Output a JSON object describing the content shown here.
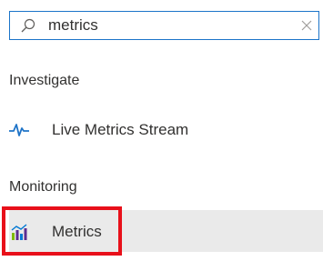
{
  "search": {
    "value": "metrics",
    "icon": "search-icon",
    "clear_icon": "close-icon"
  },
  "sections": [
    {
      "header": "Investigate",
      "items": [
        {
          "label": "Live Metrics Stream",
          "icon": "pulse-icon",
          "selected": false
        }
      ]
    },
    {
      "header": "Monitoring",
      "items": [
        {
          "label": "Metrics",
          "icon": "bar-chart-icon",
          "selected": true
        }
      ]
    }
  ],
  "colors": {
    "search_border": "#1b74c9",
    "live_icon": "#1f74c8",
    "selected_background": "#eaeaea",
    "highlight_border": "#e8101a"
  }
}
